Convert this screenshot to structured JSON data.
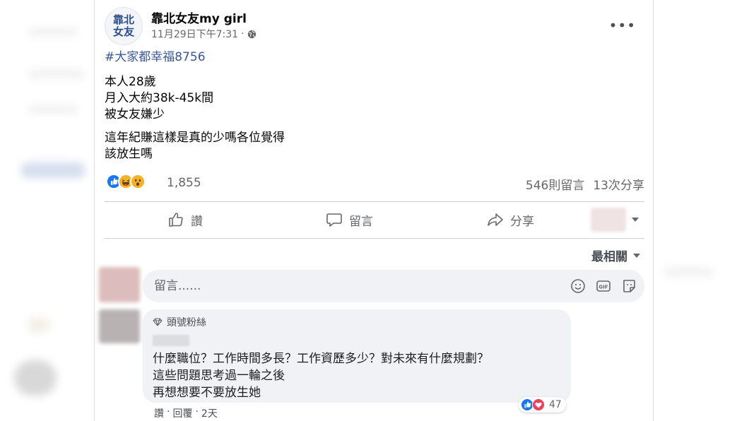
{
  "post": {
    "page_name": "靠北女友my girl",
    "avatar_text_top": "靠北",
    "avatar_text_bottom": "女友",
    "timestamp": "11月29日下午7:31",
    "separator": "·",
    "hashtag": "#大家都幸福8756",
    "body_lines": [
      "本人28歲",
      "月入大約38k-45k間",
      "被女友嫌少"
    ],
    "body_lines_2": [
      "這年紀賺這樣是真的少嗎各位覺得",
      "該放生嗎"
    ],
    "reaction_count": "1,855",
    "comment_count": "546則留言",
    "share_count": "13次分享"
  },
  "actions": {
    "like": "讚",
    "comment": "留言",
    "share": "分享"
  },
  "sort_label": "最相關",
  "composer": {
    "placeholder": "留言......"
  },
  "comment": {
    "badge": "頭號粉絲",
    "lines": [
      "什麼職位？工作時間多長？工作資歷多少？對未來有什麼規劃？",
      "這些問題思考過一輪之後",
      "再想想要不要放生她"
    ],
    "reaction_count": "47",
    "actions": [
      "讚",
      "·",
      "回覆",
      "·",
      "2天"
    ]
  },
  "colors": {
    "like_blue": "#1877f2",
    "hashtag_blue": "#385898",
    "haha_yellow": "#f7b125",
    "love_red": "#f33e58"
  },
  "icons": [
    "globe-icon",
    "more-options-icon",
    "like-icon",
    "comment-icon",
    "share-icon",
    "emoji-icon",
    "gif-icon",
    "sticker-icon",
    "diamond-icon"
  ]
}
